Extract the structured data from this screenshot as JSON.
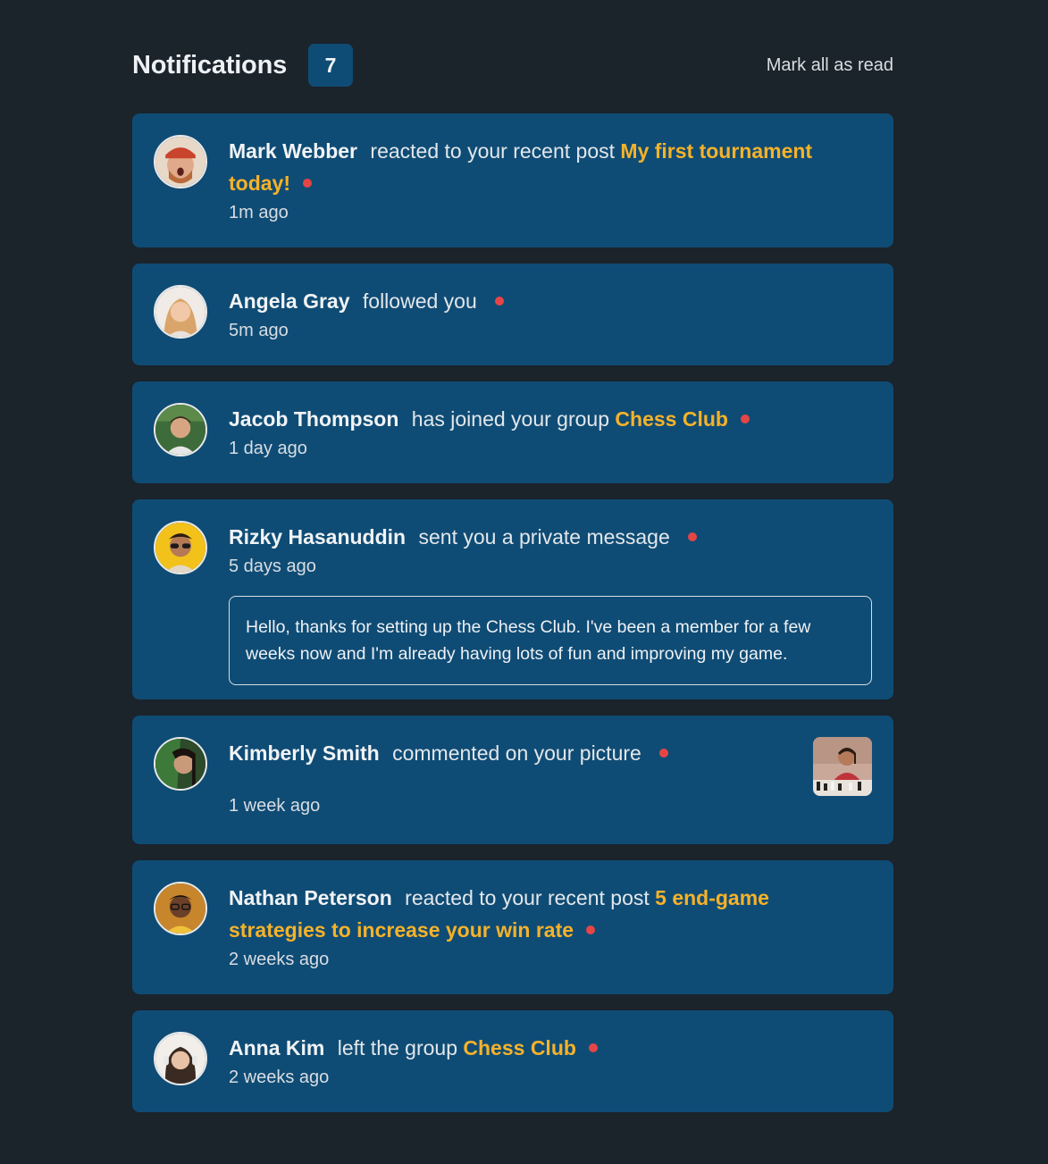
{
  "header": {
    "title": "Notifications",
    "count": "7",
    "mark_all": "Mark all as read"
  },
  "colors": {
    "background": "#1b232b",
    "card": "#0f4c75",
    "accent": "#f5b22a",
    "unread_dot": "#e64545"
  },
  "notifications": [
    {
      "name": "Mark Webber",
      "action": "reacted to your recent post",
      "target": "My first tournament today!",
      "time": "1m ago",
      "unread": true,
      "avatar_icon": "avatar-mark-webber"
    },
    {
      "name": "Angela Gray",
      "action": "followed you",
      "target": "",
      "time": "5m ago",
      "unread": true,
      "avatar_icon": "avatar-angela-gray"
    },
    {
      "name": "Jacob Thompson",
      "action": "has joined your group",
      "target": "Chess Club",
      "time": "1 day ago",
      "unread": true,
      "avatar_icon": "avatar-jacob-thompson"
    },
    {
      "name": "Rizky Hasanuddin",
      "action": "sent you a private message",
      "target": "",
      "time": "5 days ago",
      "unread": true,
      "message": "Hello, thanks for setting up the Chess Club. I've been a member for a few weeks now and I'm already having lots of fun and improving my game.",
      "avatar_icon": "avatar-rizky-hasanuddin"
    },
    {
      "name": "Kimberly Smith",
      "action": "commented on your picture",
      "target": "",
      "time": "1 week ago",
      "unread": true,
      "picture_icon": "chess-picture-thumbnail",
      "avatar_icon": "avatar-kimberly-smith"
    },
    {
      "name": "Nathan Peterson",
      "action": "reacted to your recent post",
      "target": "5 end-game strategies to increase your win rate",
      "time": "2 weeks ago",
      "unread": true,
      "avatar_icon": "avatar-nathan-peterson"
    },
    {
      "name": "Anna Kim",
      "action": "left the group",
      "target": "Chess Club",
      "time": "2 weeks ago",
      "unread": true,
      "avatar_icon": "avatar-anna-kim"
    }
  ]
}
